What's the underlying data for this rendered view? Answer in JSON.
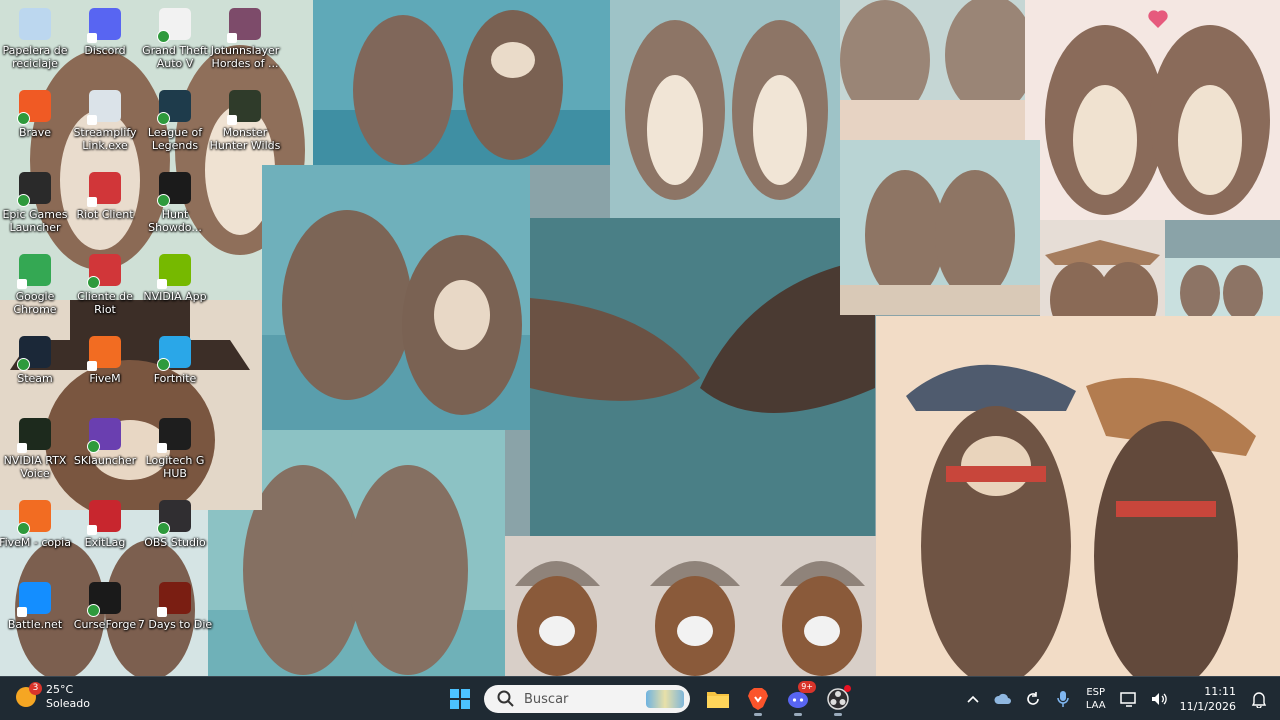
{
  "desktop": {
    "icons": [
      {
        "label": "Papelera de reciclaje",
        "icon": "recycle-bin-icon",
        "color": "#bcd7ef"
      },
      {
        "label": "Discord",
        "icon": "discord-icon",
        "color": "#5865f2"
      },
      {
        "label": "Grand Theft Auto V",
        "icon": "gta-file-icon",
        "color": "#f2f2f2"
      },
      {
        "label": "Jotunnslayer Hordes of ...",
        "icon": "jotunnslayer-icon",
        "color": "#7d4b6a"
      },
      {
        "label": "Brave",
        "icon": "brave-icon",
        "color": "#f05a24"
      },
      {
        "label": "Streamplify Link.exe",
        "icon": "streamplify-icon",
        "color": "#dbe3e9"
      },
      {
        "label": "League of Legends",
        "icon": "league-icon",
        "color": "#1e3b4b"
      },
      {
        "label": "Monster Hunter Wilds",
        "icon": "monster-hunter-icon",
        "color": "#2f3b2a"
      },
      {
        "label": "Epic Games Launcher",
        "icon": "epic-games-icon",
        "color": "#2a2a2a"
      },
      {
        "label": "Riot Client",
        "icon": "riot-client-icon",
        "color": "#d13639"
      },
      {
        "label": "Hunt Showdo...",
        "icon": "hunt-showdown-icon",
        "color": "#1b1b1b"
      },
      {
        "label": "Google Chrome",
        "icon": "chrome-icon",
        "color": "#34a853"
      },
      {
        "label": "Cliente de Riot",
        "icon": "riot-client-icon",
        "color": "#d13639"
      },
      {
        "label": "NVIDIA App",
        "icon": "nvidia-icon",
        "color": "#76b900"
      },
      {
        "label": "Steam",
        "icon": "steam-icon",
        "color": "#1b2838"
      },
      {
        "label": "FiveM",
        "icon": "fivem-icon",
        "color": "#f26c22"
      },
      {
        "label": "Fortnite",
        "icon": "fortnite-icon",
        "color": "#2aa7e8"
      },
      {
        "label": "NVIDIA RTX Voice",
        "icon": "nvidia-rtx-voice-icon",
        "color": "#1d2a1d"
      },
      {
        "label": "SKlauncher",
        "icon": "sklauncher-icon",
        "color": "#6a3fb0"
      },
      {
        "label": "Logitech G HUB",
        "icon": "logitech-icon",
        "color": "#1e1e1e"
      },
      {
        "label": "FiveM - copia",
        "icon": "fivem-icon",
        "color": "#f26c22"
      },
      {
        "label": "ExitLag",
        "icon": "exitlag-icon",
        "color": "#c8262e"
      },
      {
        "label": "OBS Studio",
        "icon": "obs-icon",
        "color": "#302e31"
      },
      {
        "label": "Battle.net",
        "icon": "battlenet-icon",
        "color": "#148eff"
      },
      {
        "label": "CurseForge",
        "icon": "curseforge-icon",
        "color": "#1a1a1a"
      },
      {
        "label": "7 Days to Die",
        "icon": "seven-days-icon",
        "color": "#7a1e12"
      }
    ]
  },
  "taskbar": {
    "weather": {
      "temp": "25°C",
      "condition": "Soleado",
      "badge": "3"
    },
    "search_placeholder": "Buscar",
    "discord_badge": "9+",
    "lang_line1": "ESP",
    "lang_line2": "LAA",
    "time": "11:11",
    "date": "11/1/2026"
  },
  "colors": {
    "taskbar_bg": "#1f2a33",
    "accent": "#0078d4"
  }
}
